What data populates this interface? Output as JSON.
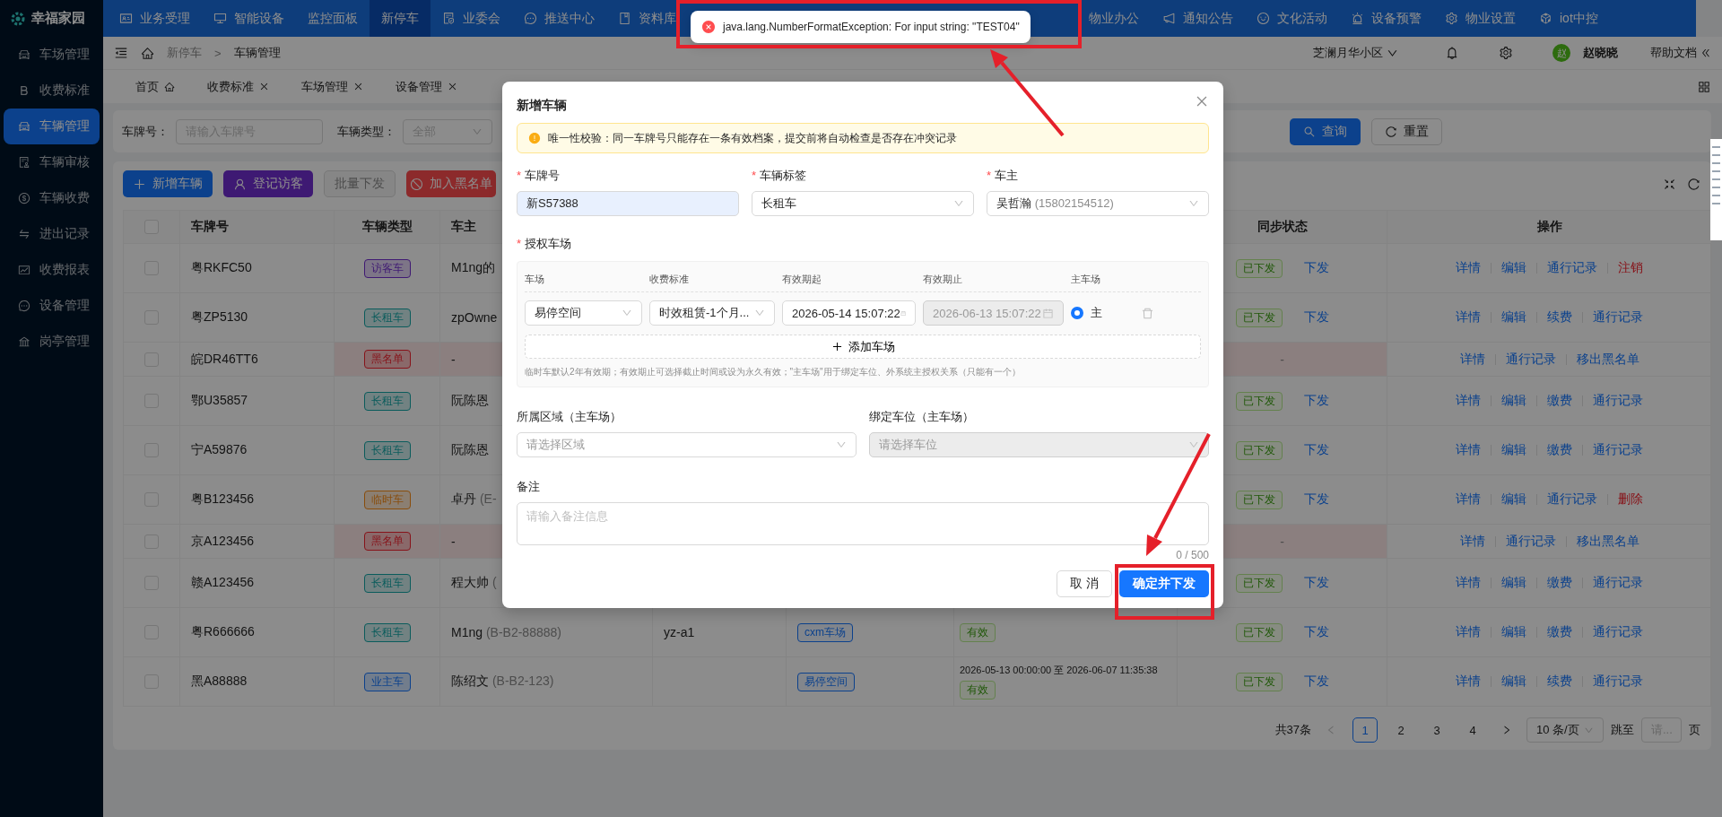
{
  "sidebar": {
    "logo": "幸福家园",
    "items": [
      {
        "label": "车场管理",
        "selected": false
      },
      {
        "label": "收费标准",
        "selected": false
      },
      {
        "label": "车辆管理",
        "selected": true
      },
      {
        "label": "车辆审核",
        "selected": false
      },
      {
        "label": "车辆收费",
        "selected": false
      },
      {
        "label": "进出记录",
        "selected": false
      },
      {
        "label": "收费报表",
        "selected": false
      },
      {
        "label": "设备管理",
        "selected": false
      },
      {
        "label": "岗亭管理",
        "selected": false
      }
    ]
  },
  "top_nav": {
    "items": [
      {
        "label": "业务受理",
        "selected": false
      },
      {
        "label": "智能设备",
        "selected": false
      },
      {
        "label": "监控面板",
        "selected": false
      },
      {
        "label": "新停车",
        "selected": true
      },
      {
        "label": "业委会",
        "selected": false
      },
      {
        "label": "推送中心",
        "selected": false
      },
      {
        "label": "资料库",
        "selected": false
      },
      {
        "label": "物业办公",
        "selected": false
      },
      {
        "label": "通知公告",
        "selected": false
      },
      {
        "label": "文化活动",
        "selected": false
      },
      {
        "label": "设备预警",
        "selected": false
      },
      {
        "label": "物业设置",
        "selected": false
      },
      {
        "label": "iot中控",
        "selected": false
      }
    ]
  },
  "header": {
    "breadcrumb": [
      "新停车",
      "车辆管理"
    ],
    "separator": ">",
    "community": "芝澜月华小区",
    "avatar": "赵",
    "user_name": "赵晓晓",
    "help": "帮助文档"
  },
  "page_tabs": [
    {
      "label": "首页",
      "kind": "home"
    },
    {
      "label": "收费标准",
      "kind": "closable"
    },
    {
      "label": "车场管理",
      "kind": "closable"
    },
    {
      "label": "设备管理",
      "kind": "closable"
    }
  ],
  "filters": [
    {
      "label": "车牌号：",
      "kind": "input",
      "placeholder": "请输入车牌号"
    },
    {
      "label": "车辆类型：",
      "kind": "select",
      "placeholder": "全部"
    }
  ],
  "filter_buttons": [
    {
      "label": "查询",
      "kind": "primary"
    },
    {
      "label": "重置",
      "kind": "default"
    }
  ],
  "toolbar": [
    {
      "label": "新增车辆",
      "kind": "primary"
    },
    {
      "label": "登记访客",
      "kind": "visitor"
    },
    {
      "label": "批量下发",
      "kind": "disabled"
    },
    {
      "label": "加入黑名单",
      "kind": "danger"
    }
  ],
  "table": {
    "all_checked": false,
    "columns": {
      "plate": "车牌号",
      "type": "车辆类型",
      "owner": "车主",
      "sync": "同步状态",
      "actions": "操作"
    },
    "rows": [
      {
        "checked": false,
        "blacklisted": false,
        "plate": "粤RKFC50",
        "type": {
          "label": "访客车",
          "color": "#3f1973"
        },
        "owner": {
          "name": "M1ng的"
        },
        "sync": {
          "status": "已下发",
          "action": "下发"
        },
        "actions": [
          {
            "label": "详情",
            "kind": "link"
          },
          {
            "label": "编辑",
            "kind": "link"
          },
          {
            "label": "通行记录",
            "kind": "link"
          },
          {
            "label": "注销",
            "kind": "danger"
          }
        ]
      },
      {
        "checked": false,
        "blacklisted": false,
        "plate": "粤ZP5130",
        "type": {
          "label": "长租车",
          "color": "#0a5c5c"
        },
        "owner": {
          "name": "zpOwne"
        },
        "sync": {
          "status": "已下发",
          "action": "下发"
        },
        "actions": [
          {
            "label": "详情",
            "kind": "link"
          },
          {
            "label": "编辑",
            "kind": "link"
          },
          {
            "label": "续费",
            "kind": "link"
          },
          {
            "label": "通行记录",
            "kind": "link"
          }
        ]
      },
      {
        "checked": false,
        "blacklisted": true,
        "plate": "皖DR46TT6",
        "type": {
          "label": "黑名单",
          "color": "#87131a"
        },
        "owner": {
          "name": "-"
        },
        "sync": {
          "status": "-"
        },
        "actions": [
          {
            "label": "详情",
            "kind": "link"
          },
          {
            "label": "通行记录",
            "kind": "link"
          },
          {
            "label": "移出黑名单",
            "kind": "link"
          }
        ]
      },
      {
        "checked": false,
        "blacklisted": false,
        "plate": "鄂U35857",
        "type": {
          "label": "长租车",
          "color": "#0a5c5c"
        },
        "owner": {
          "name": "阮陈恩"
        },
        "sync": {
          "status": "已下发",
          "action": "下发"
        },
        "actions": [
          {
            "label": "详情",
            "kind": "link"
          },
          {
            "label": "编辑",
            "kind": "link"
          },
          {
            "label": "缴费",
            "kind": "link"
          },
          {
            "label": "通行记录",
            "kind": "link"
          }
        ]
      },
      {
        "checked": false,
        "blacklisted": false,
        "plate": "宁A59876",
        "type": {
          "label": "长租车",
          "color": "#0a5c5c"
        },
        "owner": {
          "name": "阮陈恩"
        },
        "sync": {
          "status": "已下发",
          "action": "下发"
        },
        "actions": [
          {
            "label": "详情",
            "kind": "link"
          },
          {
            "label": "编辑",
            "kind": "link"
          },
          {
            "label": "缴费",
            "kind": "link"
          },
          {
            "label": "通行记录",
            "kind": "link"
          }
        ]
      },
      {
        "checked": false,
        "blacklisted": false,
        "plate": "粤B123456",
        "type": {
          "label": "临时车",
          "color": "#894d0c"
        },
        "owner": {
          "name": "卓丹",
          "note": "(E-"
        },
        "sync": {
          "status": "已下发",
          "action": "下发"
        },
        "actions": [
          {
            "label": "详情",
            "kind": "link"
          },
          {
            "label": "编辑",
            "kind": "link"
          },
          {
            "label": "通行记录",
            "kind": "link"
          },
          {
            "label": "删除",
            "kind": "danger"
          }
        ]
      },
      {
        "checked": false,
        "blacklisted": true,
        "plate": "京A123456",
        "type": {
          "label": "黑名单",
          "color": "#87131a"
        },
        "owner": {
          "name": "-"
        },
        "sync": {
          "status": "-"
        },
        "actions": [
          {
            "label": "详情",
            "kind": "link"
          },
          {
            "label": "通行记录",
            "kind": "link"
          },
          {
            "label": "移出黑名单",
            "kind": "link"
          }
        ]
      },
      {
        "checked": false,
        "blacklisted": false,
        "plate": "赣A123456",
        "type": {
          "label": "长租车",
          "color": "#0a5c5c"
        },
        "owner": {
          "name": "程大帅",
          "note": "("
        },
        "sync": {
          "status": "已下发",
          "action": "下发"
        },
        "actions": [
          {
            "label": "详情",
            "kind": "link"
          },
          {
            "label": "编辑",
            "kind": "link"
          },
          {
            "label": "缴费",
            "kind": "link"
          },
          {
            "label": "通行记录",
            "kind": "link"
          }
        ]
      },
      {
        "checked": false,
        "blacklisted": false,
        "plate": "粤R666666",
        "type": {
          "label": "长租车",
          "color": "#0a5c5c"
        },
        "owner": {
          "name": "M1ng",
          "note": "(B-B2-88888)"
        },
        "column_5": "yz-a1",
        "column_6": "cxm车场",
        "column_7": {
          "status": "有效"
        },
        "sync": {
          "status": "已下发",
          "action": "下发"
        },
        "actions": [
          {
            "label": "详情",
            "kind": "link"
          },
          {
            "label": "编辑",
            "kind": "link"
          },
          {
            "label": "缴费",
            "kind": "link"
          },
          {
            "label": "通行记录",
            "kind": "link"
          }
        ]
      },
      {
        "checked": false,
        "blacklisted": false,
        "plate": "黑A88888",
        "type": {
          "label": "业主车",
          "color": "#0c418c"
        },
        "owner": {
          "name": "陈绍文",
          "note": "(B-B2-123)"
        },
        "column_6": "易停空间",
        "column_7": {
          "dates": "2026-05-13 00:00:00 至 2026-06-07 11:35:38",
          "status": "有效"
        },
        "sync": {
          "status": "已下发",
          "action": "下发"
        },
        "actions": [
          {
            "label": "详情",
            "kind": "link"
          },
          {
            "label": "编辑",
            "kind": "link"
          },
          {
            "label": "续费",
            "kind": "link"
          },
          {
            "label": "通行记录",
            "kind": "link"
          }
        ]
      }
    ]
  },
  "pagination": {
    "total": "共37条",
    "pages": [
      {
        "label": "1",
        "selected": true
      },
      {
        "label": "2",
        "selected": false
      },
      {
        "label": "3",
        "selected": false
      },
      {
        "label": "4",
        "selected": false
      }
    ],
    "page_size": "10 条/页",
    "jump_label": "跳至",
    "jump_placeholder": "请...",
    "page_suffix": "页"
  },
  "modal": {
    "title": "新增车辆",
    "required_mark": "*",
    "alert": "唯一性校验：同一车牌号只能存在一条有效档案，提交前将自动检查是否存在冲突记录",
    "fields": [
      {
        "label": "车牌号",
        "required": true,
        "kind": "input",
        "value": "新S57388",
        "autofilled": true
      },
      {
        "label": "车辆标签",
        "required": true,
        "kind": "select",
        "value": "长租车"
      },
      {
        "label": "车主",
        "required": true,
        "kind": "select",
        "value": "吴哲瀚",
        "hint": "(15802154512)"
      }
    ],
    "parking": {
      "label": "授权车场",
      "required": true,
      "columns": [
        "车场",
        "收费标准",
        "有效期起",
        "有效期止",
        "主车场"
      ],
      "rows": [
        {
          "lot": "易停空间",
          "fee": "时效租赁-1个月...",
          "start": "2026-05-14 15:07:22",
          "end": "2026-06-13 15:07:22",
          "end_disabled": true,
          "primary": true,
          "primary_label": "主"
        }
      ],
      "add_label": "添加车场",
      "note": "临时车默认2年有效期；有效期止可选择截止时间或设为永久有效；\"主车场\"用于绑定车位、外系统主授权关系（只能有一个）"
    },
    "area_fields": [
      {
        "label": "所属区域（主车场）",
        "placeholder": "请选择区域",
        "disabled": false
      },
      {
        "label": "绑定车位（主车场）",
        "placeholder": "请选择车位",
        "disabled": true
      }
    ],
    "remark": {
      "label": "备注",
      "placeholder": "请输入备注信息",
      "counter": "0 / 500"
    },
    "buttons": [
      {
        "label": "取 消",
        "kind": "default"
      },
      {
        "label": "确定并下发",
        "kind": "primary"
      }
    ]
  },
  "toast": {
    "kind": "error",
    "message": "java.lang.NumberFormatException: For input string: \"TEST04\""
  }
}
